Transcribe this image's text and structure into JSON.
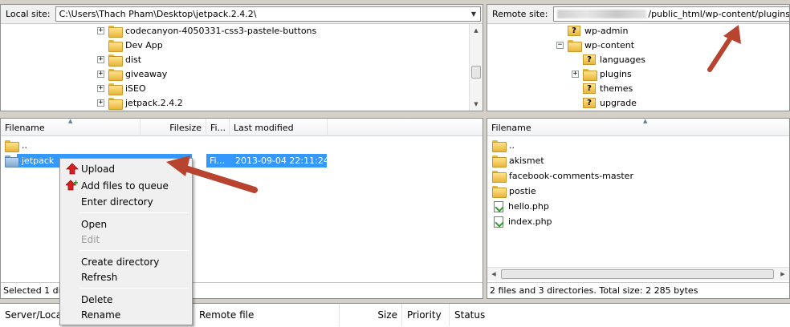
{
  "local": {
    "site_label": "Local site:",
    "path": "C:\\Users\\Thach Pham\\Desktop\\jetpack.2.4.2\\",
    "tree": [
      {
        "label": "codecanyon-4050331-css3-pastele-buttons"
      },
      {
        "label": "Dev App"
      },
      {
        "label": "dist"
      },
      {
        "label": "giveaway"
      },
      {
        "label": "iSEO"
      },
      {
        "label": "jetpack.2.4.2"
      }
    ],
    "columns": {
      "filename": "Filename",
      "filesize": "Filesize",
      "filetype": "Fi...",
      "modified": "Last modified"
    },
    "files": [
      {
        "name": "..",
        "type": "",
        "modified": ""
      },
      {
        "name": "jetpack",
        "type": "Fi...",
        "modified": "2013-09-04 22:11:24"
      }
    ],
    "status": "Selected 1 directory."
  },
  "remote": {
    "site_label": "Remote site:",
    "path_visible": "/public_html/wp-content/plugins",
    "tree": [
      {
        "label": "wp-admin"
      },
      {
        "label": "wp-content"
      },
      {
        "label": "languages"
      },
      {
        "label": "plugins"
      },
      {
        "label": "themes"
      },
      {
        "label": "upgrade"
      }
    ],
    "columns": {
      "filename": "Filename"
    },
    "files": [
      {
        "name": ".."
      },
      {
        "name": "akismet"
      },
      {
        "name": "facebook-comments-master"
      },
      {
        "name": "postie"
      },
      {
        "name": "hello.php"
      },
      {
        "name": "index.php"
      }
    ],
    "status": "2 files and 3 directories. Total size: 2 285 bytes"
  },
  "context_menu": {
    "upload": "Upload",
    "add_to_queue": "Add files to queue",
    "enter_directory": "Enter directory",
    "open": "Open",
    "edit": "Edit",
    "create_directory": "Create directory",
    "refresh": "Refresh",
    "delete": "Delete",
    "rename": "Rename"
  },
  "queue": {
    "columns": {
      "server_local": "Server/Local file",
      "remote": "Remote file",
      "size": "Size",
      "priority": "Priority",
      "status": "Status"
    }
  },
  "colors": {
    "selection": "#3399ff",
    "annotation_arrow": "#b8432f"
  }
}
